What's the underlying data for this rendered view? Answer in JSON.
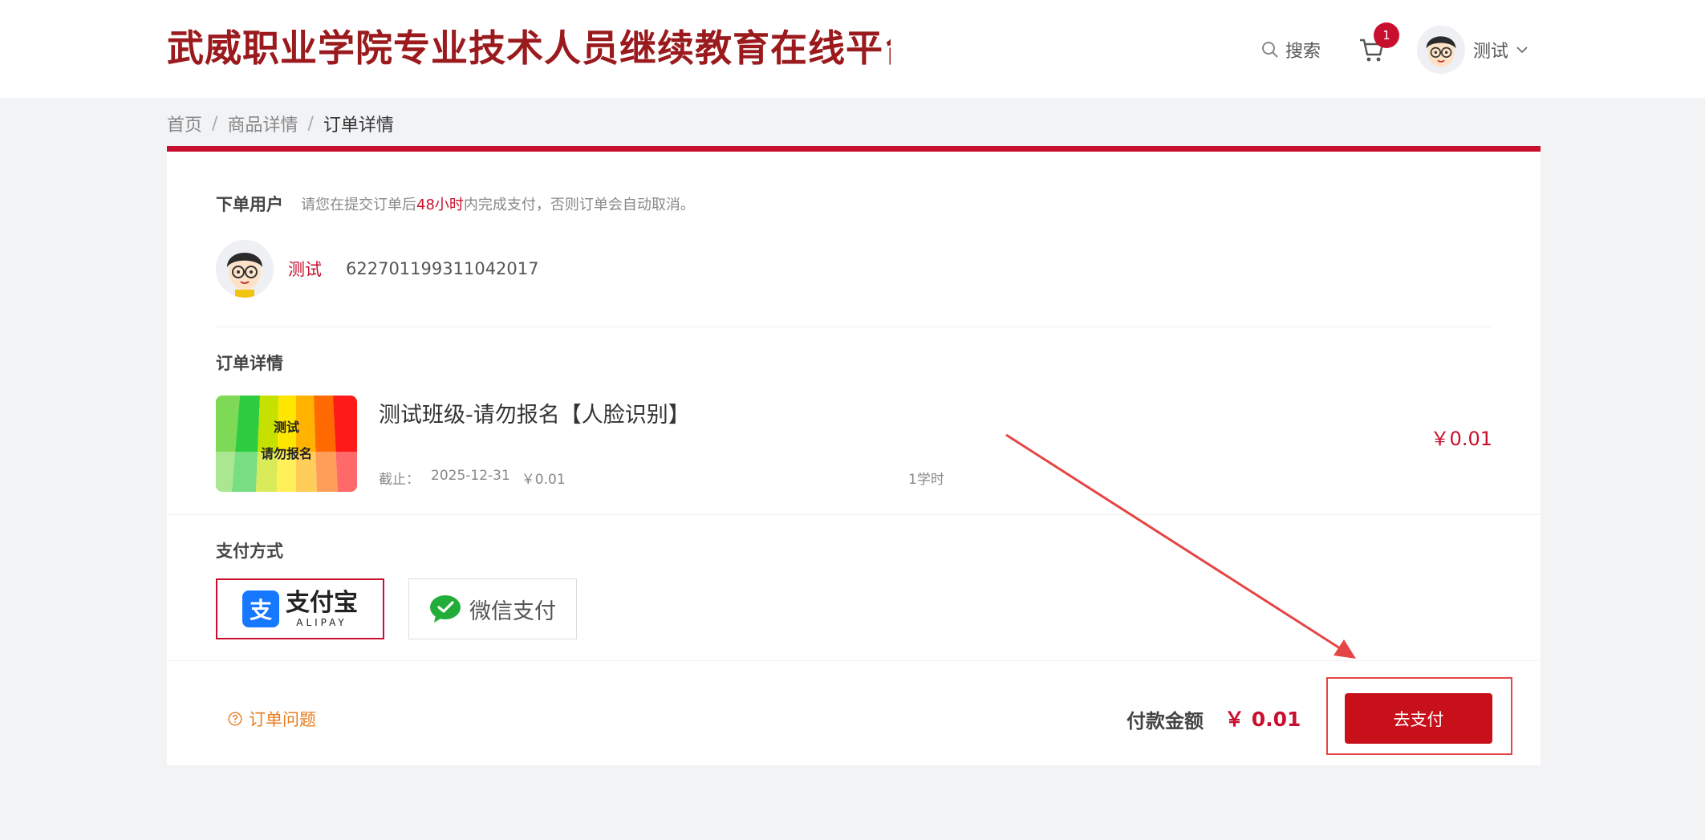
{
  "header": {
    "site_title": "武威职业学院专业技术人员继续教育在线平台",
    "search_label": "搜索",
    "cart_count": "1",
    "user_name": "测试"
  },
  "breadcrumb": {
    "items": [
      "首页",
      "商品详情",
      "订单详情"
    ]
  },
  "buyer": {
    "section_title": "下单用户",
    "notice_prefix": "请您在提交订单后",
    "notice_highlight": "48小时",
    "notice_suffix": "内完成支付，否则订单会自动取消。",
    "name": "测试",
    "id_number": "622701199311042017"
  },
  "order": {
    "section_title": "订单详情",
    "course_thumb_line1": "测试",
    "course_thumb_line2": "请勿报名",
    "course_name": "测试班级-请勿报名【人脸识别】",
    "deadline_label": "截止：",
    "deadline_value": "2025-12-31",
    "unit_price": "￥0.01",
    "hours": "1学时",
    "price": "￥0.01"
  },
  "payment": {
    "section_title": "支付方式",
    "options": [
      {
        "id": "alipay",
        "label_cn": "支付宝",
        "label_en": "ALIPAY",
        "selected": true
      },
      {
        "id": "wechat",
        "label_cn": "微信支付",
        "selected": false
      }
    ]
  },
  "footer": {
    "order_issue_label": "订单问题",
    "amount_label": "付款金额",
    "amount_value": "￥ 0.01",
    "pay_button_label": "去支付"
  },
  "colors": {
    "brand_red": "#c8102e",
    "title_red": "#9a1a1d",
    "annotation_red": "#e64545",
    "order_issue_orange": "#e67e22"
  }
}
